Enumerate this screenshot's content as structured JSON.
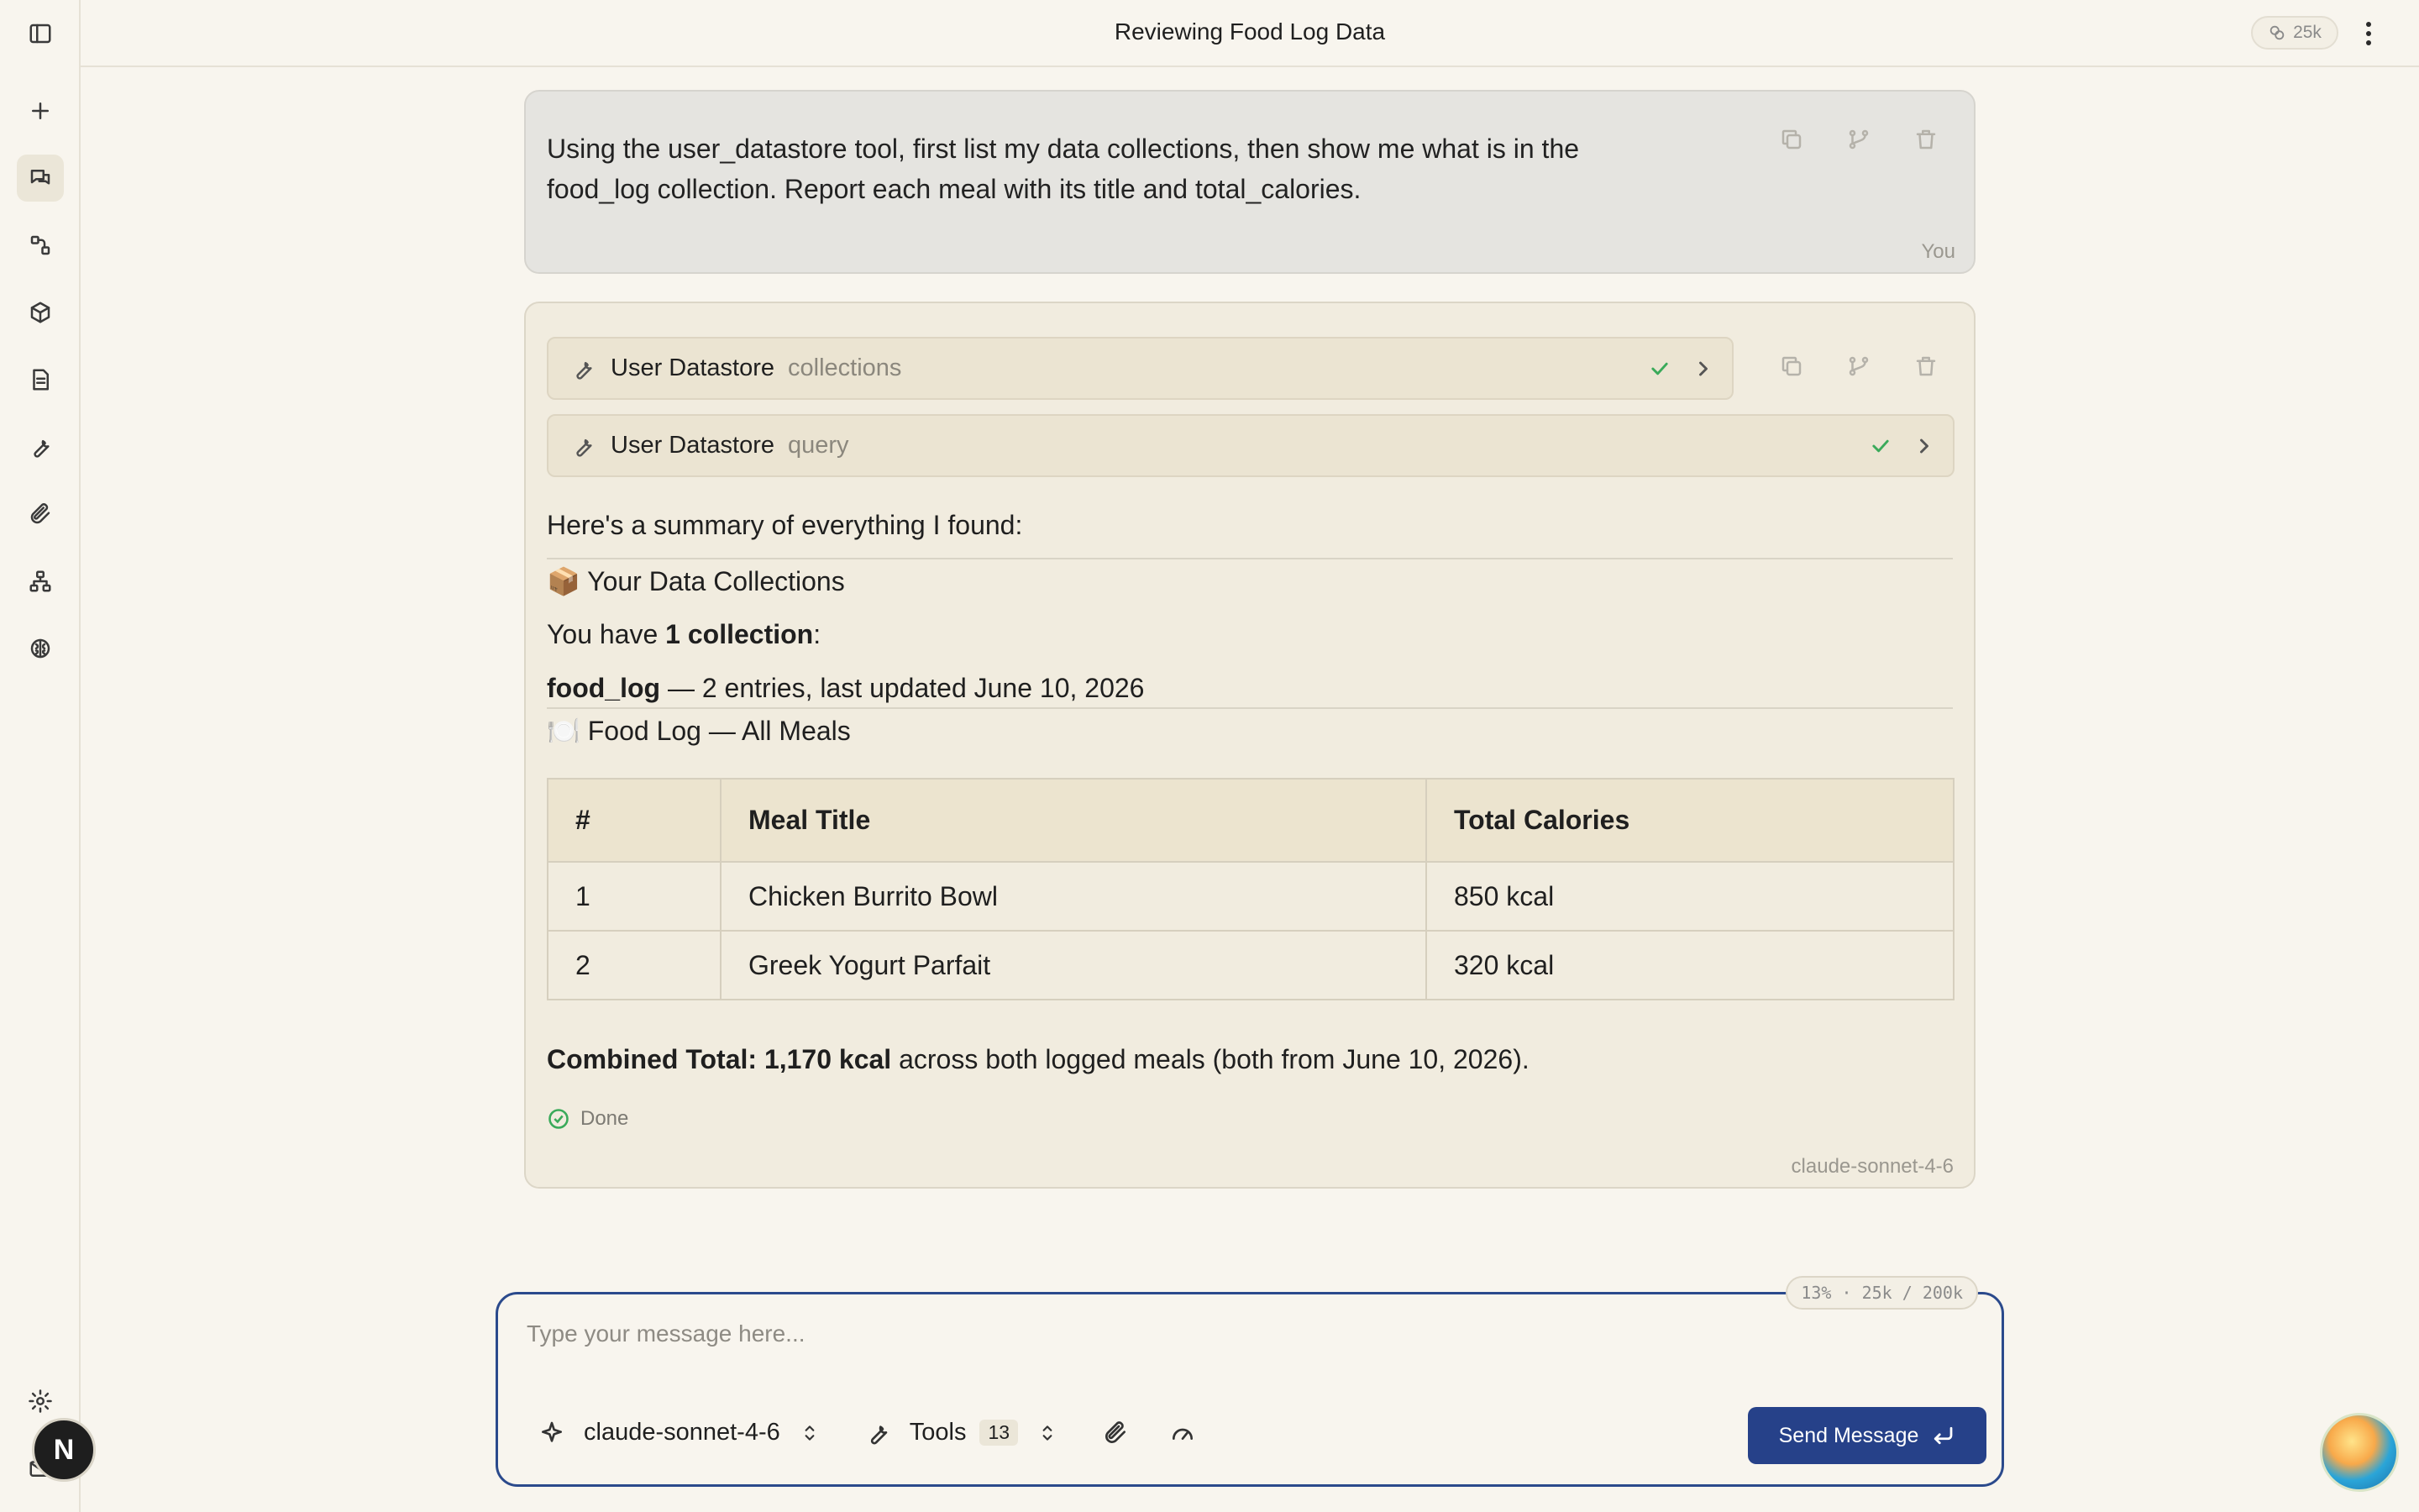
{
  "app": {
    "title": "Reviewing Food Log Data",
    "token_badge": "25k",
    "context_usage": "13% · 25k / 200k",
    "avatar_initial": "N"
  },
  "user_message": {
    "text": "Using the user_datastore tool, first list my data collections, then show me what is in the food_log collection. Report each meal with its title and total_calories.",
    "sender": "You"
  },
  "assistant_message": {
    "tool_calls": [
      {
        "name": "User Datastore",
        "operation": "collections"
      },
      {
        "name": "User Datastore",
        "operation": "query"
      }
    ],
    "intro": "Here's a summary of everything I found:",
    "section1_icon": "📦",
    "section1_title": "Your Data Collections",
    "collections_prefix": "You have ",
    "collections_bold": "1 collection",
    "collections_suffix": ":",
    "collection_name": "food_log",
    "collection_detail": " — 2 entries, last updated June 10, 2026",
    "section2_icon": "🍽️",
    "section2_title": "Food Log — All Meals",
    "table": {
      "headers": [
        "#",
        "Meal Title",
        "Total Calories"
      ],
      "rows": [
        [
          "1",
          "Chicken Burrito Bowl",
          "850 kcal"
        ],
        [
          "2",
          "Greek Yogurt Parfait",
          "320 kcal"
        ]
      ]
    },
    "total_bold": "Combined Total: 1,170 kcal",
    "total_rest": " across both logged meals (both from June 10, 2026).",
    "status": "Done",
    "model": "claude-sonnet-4-6"
  },
  "composer": {
    "placeholder": "Type your message here...",
    "model": "claude-sonnet-4-6",
    "tools_label": "Tools",
    "tools_count": "13",
    "send_label": "Send Message"
  },
  "colors": {
    "accent": "#264189",
    "success": "#3aaa5a",
    "background": "#f8f5ee"
  }
}
